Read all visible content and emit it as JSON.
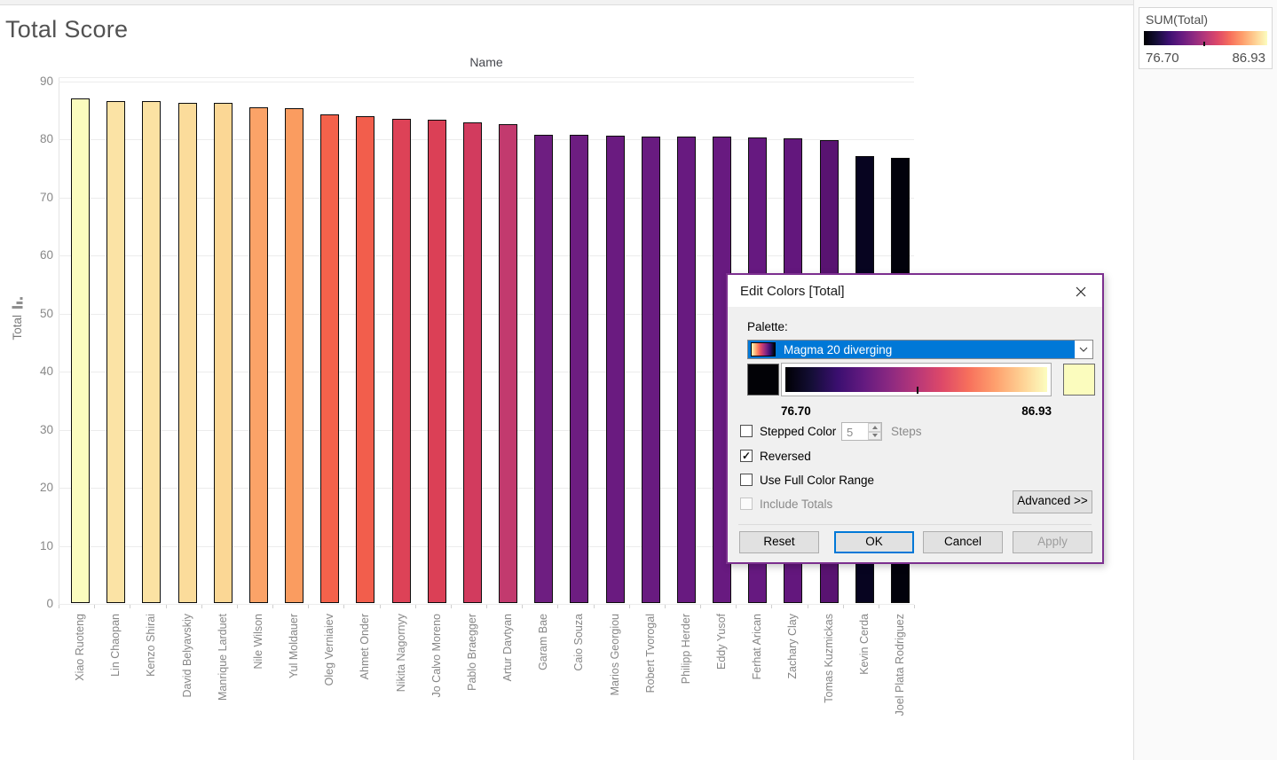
{
  "page": {
    "title": "Total Score"
  },
  "chart": {
    "column_field_label": "Name",
    "y_axis_label": "Total"
  },
  "legend": {
    "title": "SUM(Total)",
    "min_label": "76.70",
    "max_label": "86.93"
  },
  "dialog": {
    "title": "Edit Colors [Total]",
    "palette_label": "Palette:",
    "palette_value": "Magma 20 diverging",
    "gradient_min": "76.70",
    "gradient_max": "86.93",
    "stepped_color": {
      "label": "Stepped Color",
      "checked": false
    },
    "steps": {
      "value": "5",
      "label": "Steps"
    },
    "reversed": {
      "label": "Reversed",
      "checked": true
    },
    "use_full_color_range": {
      "label": "Use Full Color Range",
      "checked": false
    },
    "include_totals": {
      "label": "Include Totals",
      "checked": false,
      "disabled": true
    },
    "advanced_button": "Advanced >>",
    "reset_button": "Reset",
    "ok_button": "OK",
    "cancel_button": "Cancel",
    "apply_button": "Apply"
  },
  "colors": {
    "accent_blue": "#0078D7",
    "dialog_border": "#7C2F8F",
    "bar_border": "#0D0D0D",
    "magma_stops": [
      "#000004",
      "#140E36",
      "#3B0F70",
      "#641A80",
      "#8C2981",
      "#B73779",
      "#DE4968",
      "#F7705C",
      "#FE9F6D",
      "#FECF92",
      "#FCFDBF"
    ]
  },
  "chart_data": {
    "type": "bar",
    "title": "Total Score",
    "xlabel": "Name",
    "ylabel": "Total",
    "ylim": [
      0,
      90
    ],
    "yticks": [
      0,
      10,
      20,
      30,
      40,
      50,
      60,
      70,
      80,
      90
    ],
    "grid": true,
    "legend_position": "top-right",
    "color_encoding": {
      "field": "SUM(Total)",
      "min": 76.7,
      "max": 86.93,
      "palette": "Magma 20 diverging",
      "reversed": true
    },
    "categories": [
      "Xiao Ruoteng",
      "Lin Chaopan",
      "Kenzo Shirai",
      "David Belyavskiy",
      "Manrique Larduet",
      "Nile Wilson",
      "Yul Moldauer",
      "Oleg Verniaiev",
      "Ahmet Onder",
      "Nikita Nagornyy",
      "Jo Calvo Moreno",
      "Pablo Braegger",
      "Artur Davtyan",
      "Garam Bae",
      "Caio Souza",
      "Marios Georgiou",
      "Robert Tvorogal",
      "Philipp Herder",
      "Eddy Yusof",
      "Ferhat Arican",
      "Zachary Clay",
      "Tomas Kuzmickas",
      "Kevin Cerda",
      "Joel Plata Rodriguez"
    ],
    "values": [
      86.93,
      86.45,
      86.43,
      86.25,
      86.15,
      85.45,
      85.25,
      84.15,
      83.95,
      83.45,
      83.3,
      82.85,
      82.45,
      80.7,
      80.65,
      80.45,
      80.4,
      80.35,
      80.35,
      80.2,
      80.05,
      79.8,
      77.05,
      76.7
    ],
    "bar_colors": [
      "#FBFCBE",
      "#FBE3A5",
      "#FBE2A3",
      "#FBDC9B",
      "#FBD795",
      "#FBA368",
      "#FA9C60",
      "#F4624B",
      "#F25E4C",
      "#DD4257",
      "#DB4056",
      "#D23B5E",
      "#C23A6E",
      "#6E1E81",
      "#6D1D81",
      "#6A1B80",
      "#691B80",
      "#681A80",
      "#681A80",
      "#661980",
      "#63177D",
      "#591371",
      "#070420",
      "#02020B"
    ]
  }
}
